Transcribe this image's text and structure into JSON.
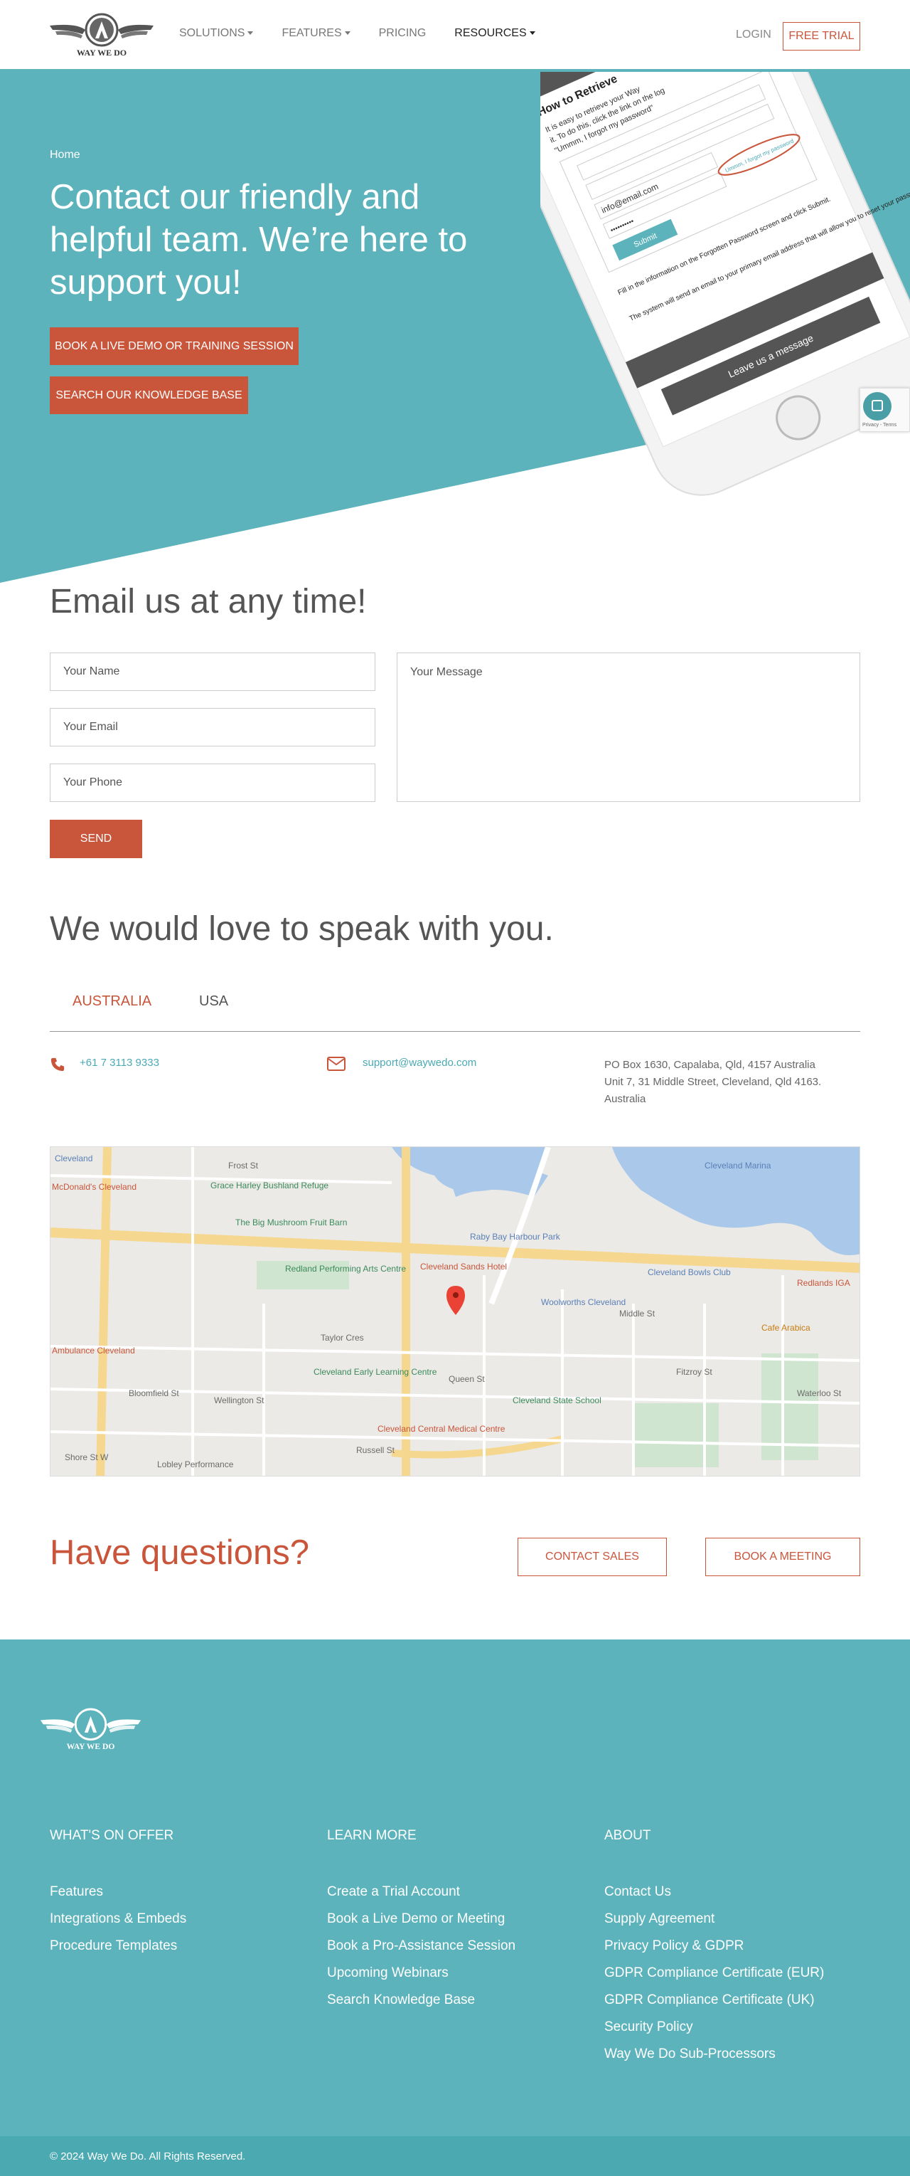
{
  "nav": {
    "logo_text": "WAY WE DO",
    "items": [
      {
        "label": "SOLUTIONS",
        "dropdown": true
      },
      {
        "label": "FEATURES",
        "dropdown": true
      },
      {
        "label": "PRICING",
        "dropdown": false
      },
      {
        "label": "RESOURCES",
        "dropdown": true
      }
    ],
    "login": "LOGIN",
    "free_trial": "FREE TRIAL"
  },
  "hero": {
    "breadcrumb": "Home",
    "title": "Contact our friendly and helpful team. We’re here to support you!",
    "demo_button": "BOOK A LIVE DEMO OR TRAINING SESSION",
    "kb_button": "SEARCH OUR KNOWLEDGE BASE",
    "phone_screen": {
      "heading": "How to Retrieve",
      "line1": "It is easy to retrieve your Way",
      "line2": "it. To do this, click the link on the log",
      "line3": "\"Ummm, I forgot my password\"",
      "email_value": "info@email.com",
      "password_value": "••••••••••",
      "forgot_link": "Ummm, I forgot my password",
      "submit": "Submit",
      "step1": "Fill in the information on the Forgotten Password screen and click Submit.",
      "step2": "The system will send an email to your primary email address that will allow you to reset your password.",
      "leave_message": "Leave us a message"
    },
    "recaptcha_text": "Privacy - Terms"
  },
  "email_form": {
    "title": "Email us at any time!",
    "name_placeholder": "Your Name",
    "email_placeholder": "Your Email",
    "phone_placeholder": "Your Phone",
    "message_placeholder": "Your Message",
    "send": "SEND"
  },
  "speak": {
    "title": "We would love to speak with you.",
    "tabs": [
      "AUSTRALIA",
      "USA"
    ],
    "phone": "+61 7 3113 9333",
    "email": "support@waywedo.com",
    "address_line1": "PO Box 1630, Capalaba, Qld, 4157 Australia",
    "address_line2": "Unit 7, 31 Middle Street, Cleveland, Qld 4163.",
    "address_line3": "Australia"
  },
  "map": {
    "labels": [
      "Cleveland",
      "Frost St",
      "Grace Harley Bushland Refuge",
      "McDonald's Cleveland",
      "The Big Mushroom Fruit Barn",
      "Raby Bay Harbour Park",
      "Cleveland Marina",
      "Redland Performing Arts Centre",
      "Cleveland Sands Hotel",
      "Cleveland Bowls Club",
      "Woolworths Cleveland",
      "Middle St",
      "Taylor Cres",
      "Cleveland Early Learning Centre",
      "Queen St",
      "Cleveland State School",
      "Cleveland Central Medical Centre",
      "Lobley Performance",
      "Russell St",
      "Redlands IGA",
      "Cafe Arabica",
      "Wellington St",
      "Bloomfield St",
      "Shore St W",
      "Waterloo St",
      "Fitzroy St",
      "Ambulance Cleveland"
    ]
  },
  "cta": {
    "title": "Have questions?",
    "contact_sales": "CONTACT SALES",
    "book_meeting": "BOOK A MEETING"
  },
  "footer": {
    "logo_text": "WAY WE DO",
    "columns": [
      {
        "heading": "WHAT'S ON OFFER",
        "links": [
          "Features",
          "Integrations & Embeds",
          "Procedure Templates"
        ]
      },
      {
        "heading": "LEARN MORE",
        "links": [
          "Create a Trial Account",
          "Book a Live Demo or Meeting",
          "Book a Pro-Assistance Session",
          "Upcoming Webinars",
          "Search Knowledge Base"
        ]
      },
      {
        "heading": "ABOUT",
        "links": [
          "Contact Us",
          "Supply Agreement",
          "Privacy Policy & GDPR",
          "GDPR Compliance Certificate (EUR)",
          "GDPR Compliance Certificate (UK)",
          "Security Policy",
          "Way We Do Sub-Processors"
        ]
      }
    ],
    "copyright": "© 2024 Way We Do. All Rights Reserved."
  },
  "colors": {
    "teal": "#5cb3bb",
    "accent": "#c9553b",
    "link": "#4aa9b4"
  }
}
